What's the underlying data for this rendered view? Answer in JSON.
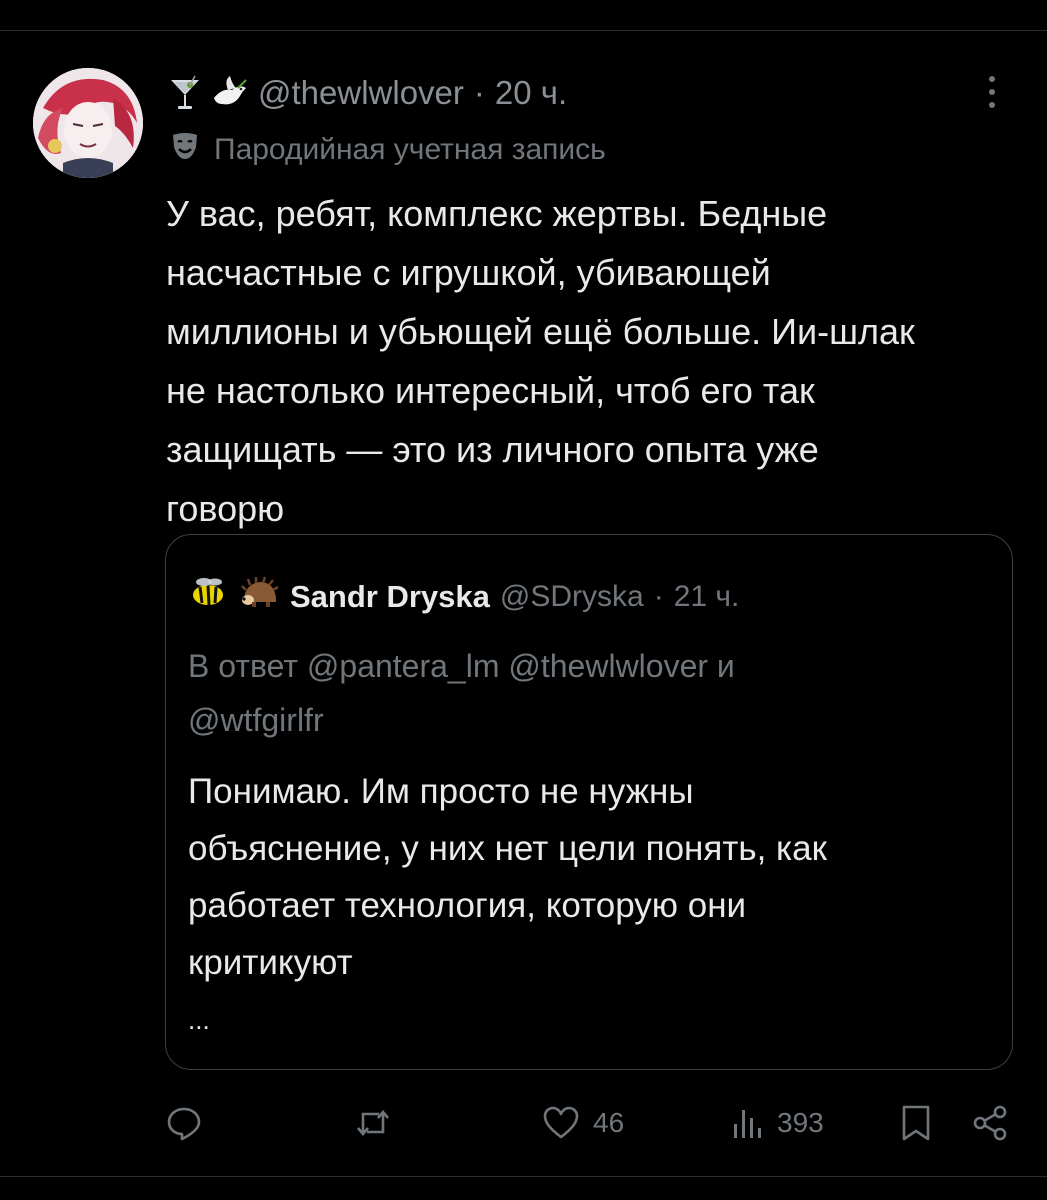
{
  "author": {
    "emojis": [
      "cocktail-emoji",
      "dove-emoji"
    ],
    "handle": "@thewlwlover",
    "separator": "·",
    "time": "20 ч.",
    "parody_label": "Пародийная учетная запись"
  },
  "post": {
    "text": "У вас, ребят, комплекс жертвы. Бедные\nнасчастные с игрушкой, убивающей\nмиллионы и убьющей ещё больше. Ии-шлак\nне настолько интересный, чтоб его так\nзащищать — это из личного опыта уже\nговорю"
  },
  "quote": {
    "icons": [
      "bee-emoji",
      "hedgehog-emoji"
    ],
    "name": "Sandr Dryska",
    "handle": "@SDryska",
    "separator": "·",
    "time": "21 ч.",
    "reply_prefix": "В ответ",
    "reply_users": [
      "@pantera_lm",
      "@thewlwlover"
    ],
    "reply_and": "и",
    "reply_last": "@wtfgirlfr",
    "text": "Понимаю. Им просто не нужны\nобъяснение, у них нет цели понять, как\nработает технология, которую они\nкритикуют",
    "ellipsis": "..."
  },
  "actions": {
    "reply_count": "",
    "repost_count": "",
    "like_count": "46",
    "views_count": "393"
  },
  "colors": {
    "background": "#000000",
    "text": "#e7e9ea",
    "muted": "#71767b",
    "border": "#3c4046"
  }
}
